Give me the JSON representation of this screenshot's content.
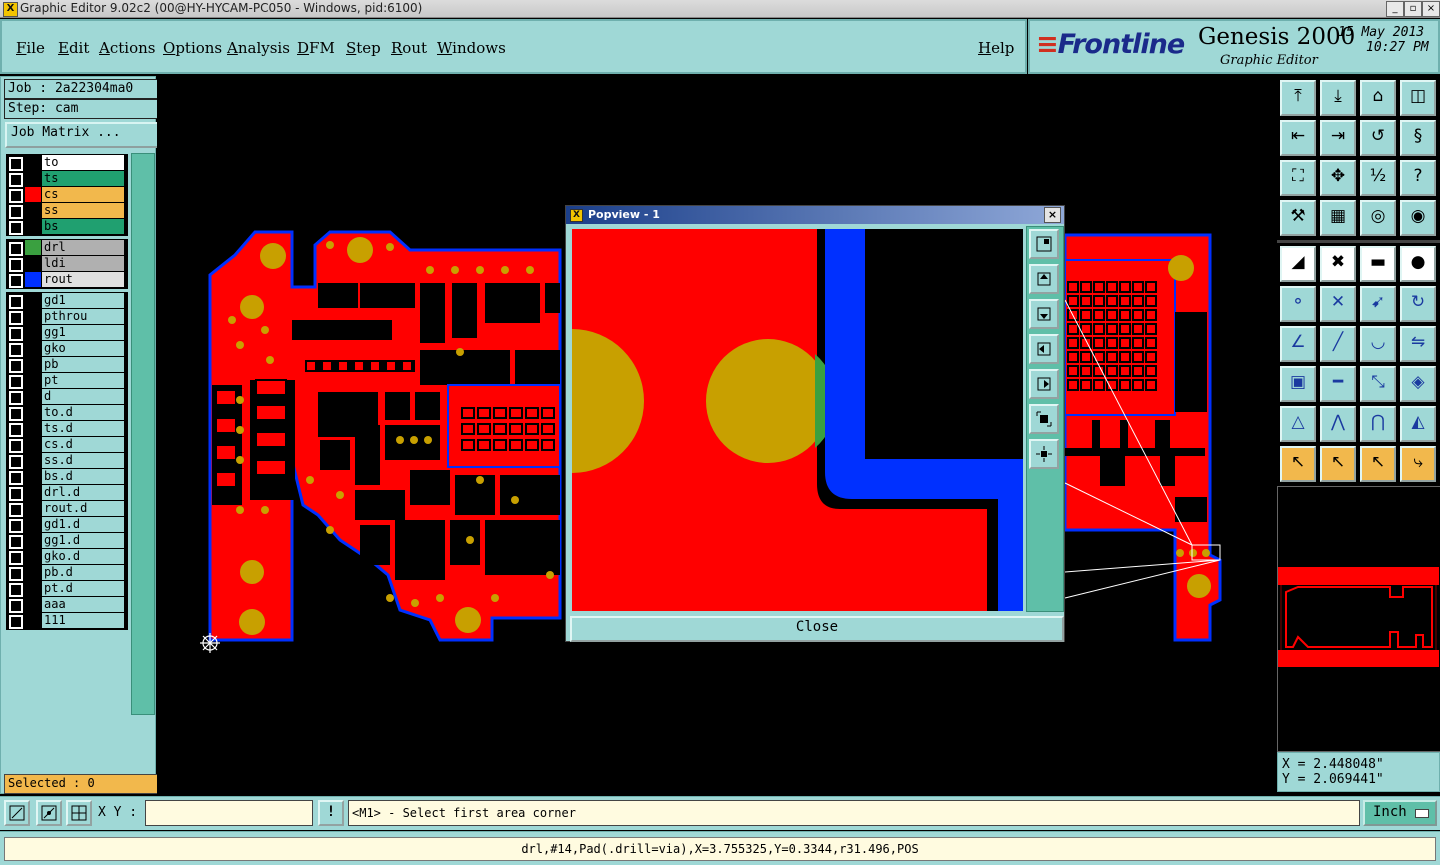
{
  "window": {
    "title": "Graphic Editor 9.02c2 (00@HY-HYCAM-PC050 - Windows, pid:6100)",
    "app_icon": "x-logo-icon"
  },
  "menu": [
    {
      "label": "File"
    },
    {
      "label": "Edit"
    },
    {
      "label": "Actions"
    },
    {
      "label": "Options"
    },
    {
      "label": "Analysis"
    },
    {
      "label": "DFM"
    },
    {
      "label": "Step"
    },
    {
      "label": "Rout"
    },
    {
      "label": "Windows"
    },
    {
      "label": "Help"
    }
  ],
  "brand": {
    "logo": "Frontline",
    "product": "Genesis 2000",
    "subtitle": "Graphic Editor",
    "date": "15 May 2013",
    "time": "10:27 PM"
  },
  "job": {
    "job_line": "Job : 2a22304ma0",
    "step_line": "Step: cam",
    "matrix_button": "Job Matrix ..."
  },
  "layers_board": [
    {
      "name": "to",
      "color": "#ffffff",
      "swatch": ""
    },
    {
      "name": "ts",
      "color": "#20a070",
      "swatch": ""
    },
    {
      "name": "cs",
      "color": "#f2b84c",
      "swatch": "#ff0000"
    },
    {
      "name": "ss",
      "color": "#f2b84c",
      "swatch": ""
    },
    {
      "name": "bs",
      "color": "#20a070",
      "swatch": ""
    }
  ],
  "layers_drill": [
    {
      "name": "drl",
      "color": "#b0b0b0",
      "swatch": "#3aa040"
    },
    {
      "name": "ldi",
      "color": "#b0b0b0",
      "swatch": ""
    },
    {
      "name": "rout",
      "color": "#e0e0e0",
      "swatch": "#0030ff"
    }
  ],
  "layers_misc": [
    "gd1",
    "pthrou",
    "gg1",
    "gko",
    "pb",
    "pt",
    "d",
    "to.d",
    "ts.d",
    "cs.d",
    "ss.d",
    "bs.d",
    "drl.d",
    "rout.d",
    "gd1.d",
    "gg1.d",
    "gko.d",
    "pb.d",
    "pt.d",
    "aaa",
    "111"
  ],
  "selected": "Selected : 0",
  "popview": {
    "title": "Popview - 1",
    "close_label": "Close"
  },
  "coords": {
    "x": "X = 2.448048\"",
    "y": "Y = 2.069441\""
  },
  "bottom": {
    "xy_label": "X Y :",
    "xy_value": "",
    "warn": "!",
    "prompt": "<M1> - Select first area corner",
    "units": "Inch"
  },
  "status": "drl,#14,Pad(.drill=via),X=3.755325,Y=0.3344,r31.496,POS",
  "colors": {
    "copper": "#ff0000",
    "drill": "#c8a000",
    "rout": "#0030ff",
    "panel": "#9fd8d6"
  }
}
